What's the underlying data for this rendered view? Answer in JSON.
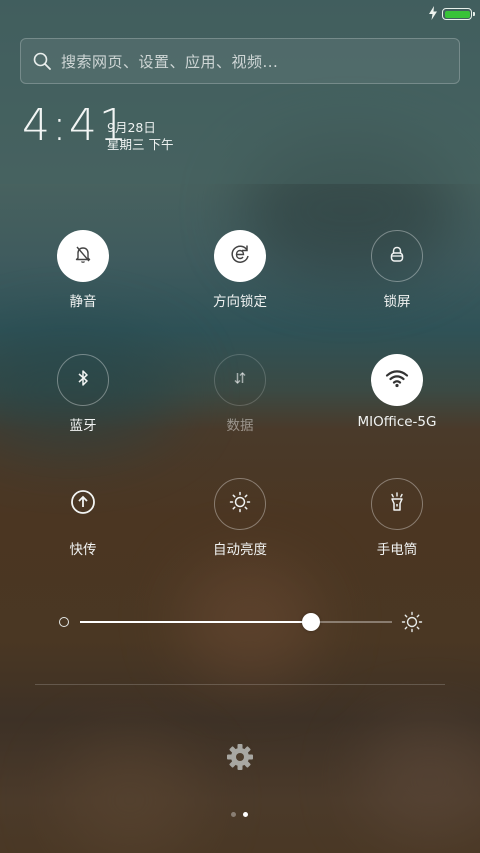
{
  "status_bar": {
    "charging_icon": "lightning-icon",
    "battery_icon": "battery-icon",
    "battery_level": 1.0,
    "battery_color": "#38c338"
  },
  "search": {
    "placeholder": "搜索网页、设置、应用、视频..."
  },
  "clock": {
    "hour": "4",
    "separator": ":",
    "minutes": "41",
    "date": "9月28日",
    "weekday": "星期三 下午"
  },
  "toggles": [
    {
      "label": "静音",
      "icon": "bell-off-icon",
      "state": "on"
    },
    {
      "label": "方向锁定",
      "icon": "rotation-lock-icon",
      "state": "on"
    },
    {
      "label": "锁屏",
      "icon": "lock-icon",
      "state": "off"
    },
    {
      "label": "蓝牙",
      "icon": "bluetooth-icon",
      "state": "off"
    },
    {
      "label": "数据",
      "icon": "mobile-data-icon",
      "state": "disabled"
    },
    {
      "label": "MIOffice-5G",
      "icon": "wifi-icon",
      "state": "on"
    },
    {
      "label": "快传",
      "icon": "quick-transfer-icon",
      "state": "off"
    },
    {
      "label": "自动亮度",
      "icon": "auto-brightness-icon",
      "state": "off"
    },
    {
      "label": "手电筒",
      "icon": "flashlight-icon",
      "state": "off"
    }
  ],
  "brightness": {
    "level": 0.74,
    "min_icon": "brightness-low-icon",
    "max_icon": "brightness-high-icon"
  },
  "settings_icon": "gear-icon",
  "pagination": {
    "pages": 2,
    "current": 2
  },
  "colors": {
    "active_tile": "#ffffff",
    "accent": "#ffffff"
  }
}
